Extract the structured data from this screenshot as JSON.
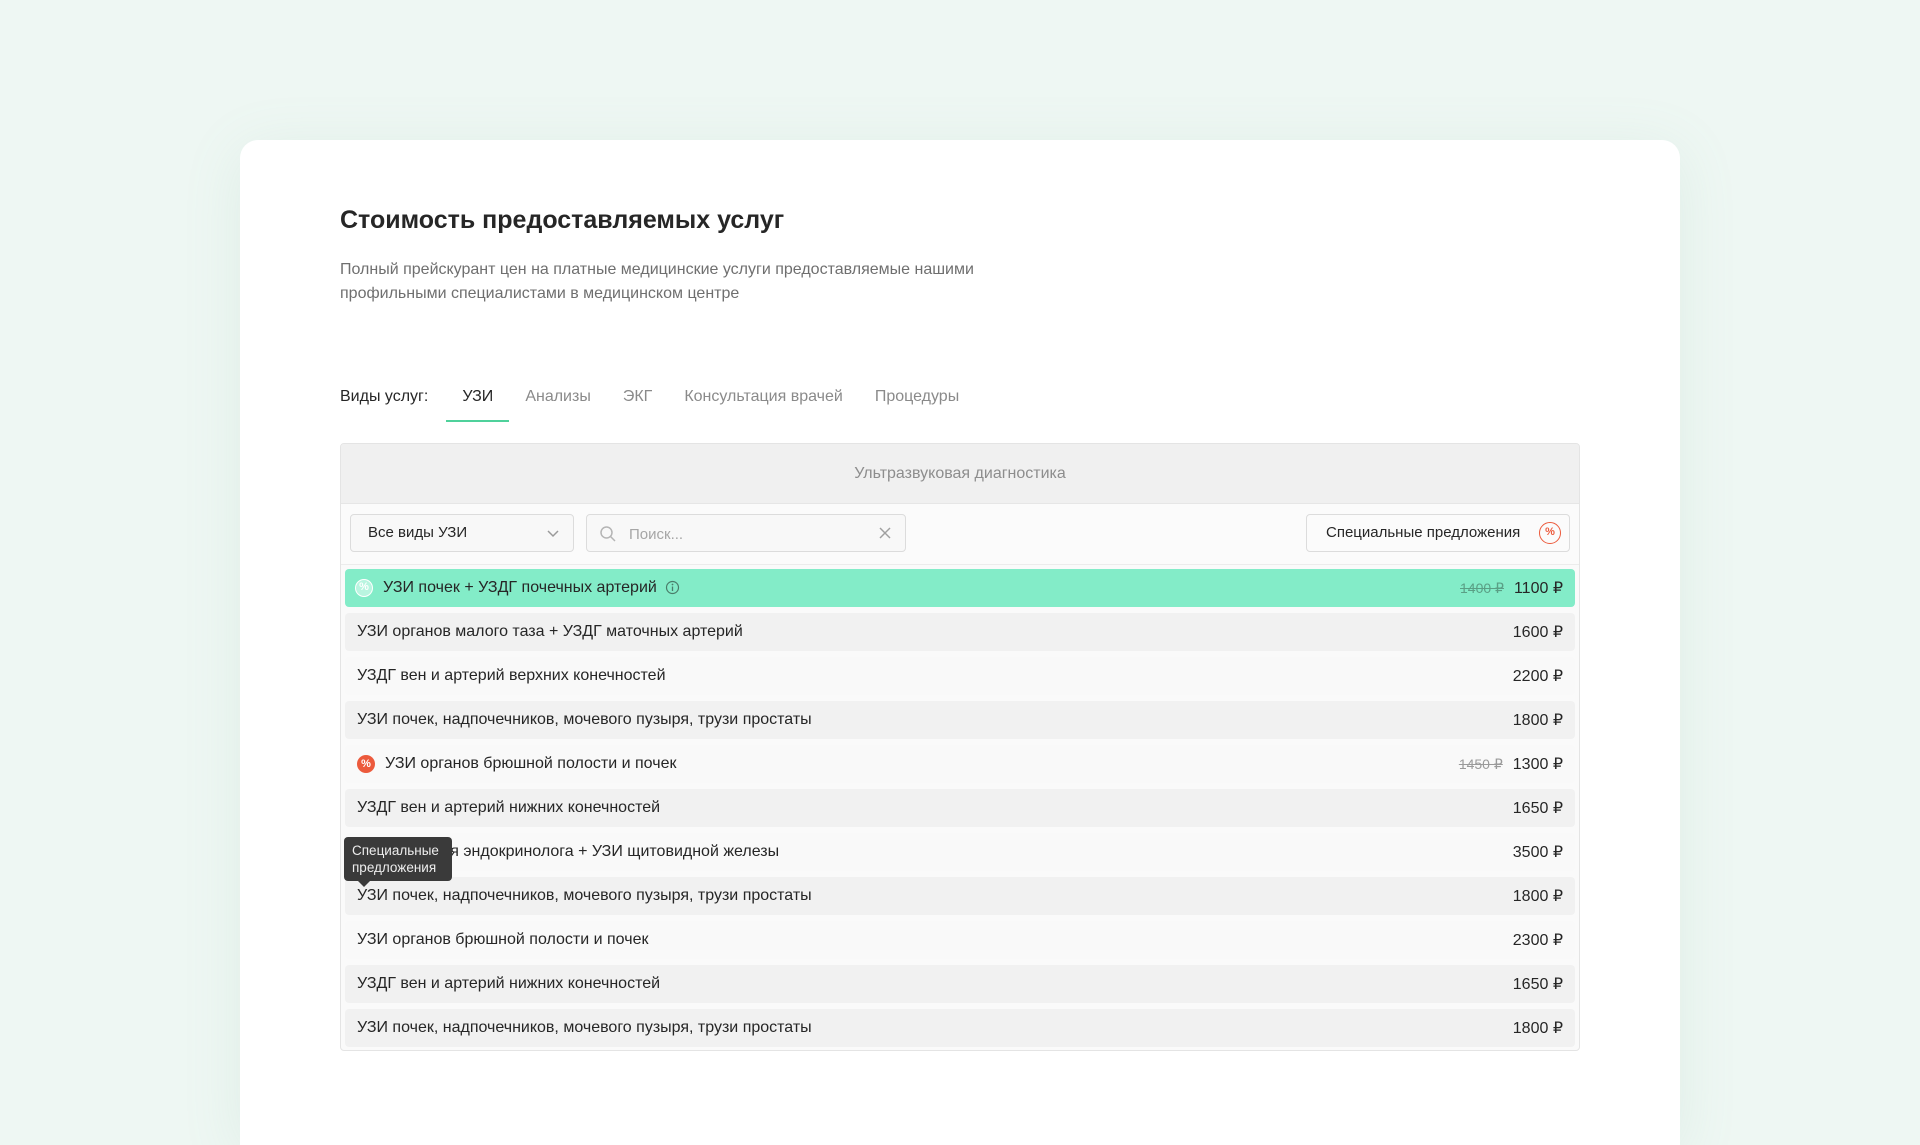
{
  "page": {
    "title": "Стоимость предоставляемых услуг",
    "subtitle": "Полный прейскурант цен на платные медицинские услуги предоставляемые нашими профильными специалистами в медицинском центре"
  },
  "tabs": {
    "label": "Виды услуг:",
    "items": [
      "УЗИ",
      "Анализы",
      "ЭКГ",
      "Консультация врачей",
      "Процедуры"
    ],
    "active": "УЗИ"
  },
  "panel": {
    "header": "Ультразвуковая диагностика",
    "select_value": "Все виды УЗИ",
    "search_placeholder": "Поиск...",
    "special_button": "Специальные предложения",
    "special_badge": "%",
    "accent_color": "#4fd19b",
    "highlight_color": "#83ecc8",
    "promo_color": "#ec5a3c"
  },
  "tooltip": "Специальные предложения",
  "rows": [
    {
      "name": "УЗИ почек + УЗДГ почечных артерий",
      "price": "1100 ₽",
      "old_price": "1400 ₽",
      "promo": true
    },
    {
      "name": "УЗИ органов малого таза + УЗДГ маточных артерий",
      "price": "1600 ₽"
    },
    {
      "name": "УЗДГ вен и артерий верхних конечностей",
      "price": "2200 ₽"
    },
    {
      "name": "УЗИ почек, надпочечников, мочевого пузыря, трузи простаты",
      "price": "1800 ₽"
    },
    {
      "name": "УЗИ органов брюшной полости и почек",
      "price": "1300 ₽",
      "old_price": "1450 ₽",
      "promo": true
    },
    {
      "name": "УЗДГ вен и артерий нижних конечностей",
      "price": "1650 ₽"
    },
    {
      "name": "Консультация эндокринолога + УЗИ щитовидной железы",
      "price": "3500 ₽"
    },
    {
      "name": "УЗИ почек, надпочечников, мочевого пузыря, трузи простаты",
      "price": "1800 ₽"
    },
    {
      "name": "УЗИ органов брюшной полости и почек",
      "price": "2300 ₽"
    },
    {
      "name": "УЗДГ вен и артерий нижних конечностей",
      "price": "1650 ₽"
    },
    {
      "name": "УЗИ почек, надпочечников, мочевого пузыря, трузи простаты",
      "price": "1800 ₽"
    }
  ]
}
